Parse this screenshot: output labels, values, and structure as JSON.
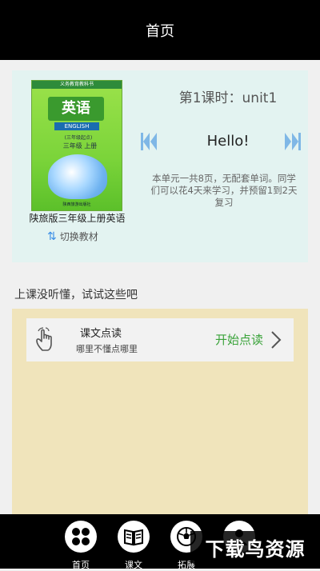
{
  "header": {
    "title": "首页"
  },
  "book": {
    "cover": {
      "series": "义务教育教科书",
      "title": "英语",
      "subtitle": "ENGLISH",
      "level": "(三年级起点)",
      "grade": "三年级 上册",
      "publisher": "陕西旅游出版社"
    },
    "name": "陕旅版三年级上册英语",
    "switch_label": "切换教材"
  },
  "lesson": {
    "title": "第1课时：unit1",
    "word": "Hello!",
    "description": "本单元一共8页，无配套单词。同学们可以花4天来学习，并预留1到2天复习"
  },
  "hint": "上课没听懂，试试这些吧",
  "reading_card": {
    "title": "课文点读",
    "subtitle": "哪里不懂点哪里",
    "action": "开始点读"
  },
  "tabs": [
    {
      "label": "首页",
      "icon": "grid-icon"
    },
    {
      "label": "课文",
      "icon": "book-icon"
    },
    {
      "label": "拓展",
      "icon": "ball-icon"
    },
    {
      "label": "",
      "icon": "profile-icon"
    }
  ],
  "watermark": "下载鸟资源",
  "colors": {
    "accent_green": "#3aa33a",
    "arrow_blue": "#7fb7e6",
    "card_bg": "#e3f3f1",
    "panel_bg": "#f0e4bb"
  }
}
